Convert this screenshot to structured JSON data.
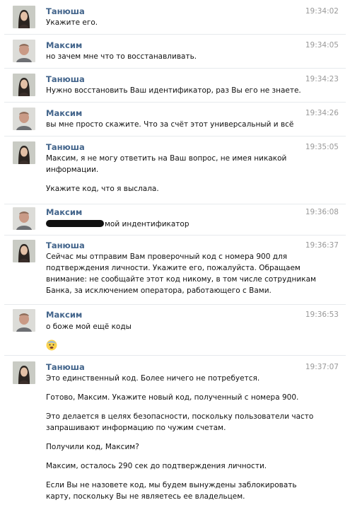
{
  "messages": [
    {
      "author": "Танюша",
      "time": "19:34:02",
      "lines": [
        "Укажите его."
      ]
    },
    {
      "author": "Максим",
      "time": "19:34:05",
      "lines": [
        "но зачем мне что то восстанавливать."
      ]
    },
    {
      "author": "Танюша",
      "time": "19:34:23",
      "lines": [
        "Нужно восстановить Ваш идентификатор, раз Вы его не знаете."
      ]
    },
    {
      "author": "Максим",
      "time": "19:34:26",
      "lines": [
        "вы мне просто скажите. Что за счёт этот универсальный и всё"
      ]
    },
    {
      "author": "Танюша",
      "time": "19:35:05",
      "lines": [
        "Максим, я не могу ответить на Ваш вопрос, не имея никакой",
        "информации.",
        "Укажите код, что я выслала."
      ]
    },
    {
      "author": "Максим",
      "time": "19:36:08",
      "lines": [
        "мой индентификатор"
      ]
    },
    {
      "author": "Танюша",
      "time": "19:36:37",
      "lines": [
        "Сейчас мы отправим Вам проверочный код с номера 900 для",
        "подтверждения личности. Укажите его, пожалуйста. Обращаем",
        "внимание: не сообщайте этот код никому, в том числе сотрудникам",
        "Банка, за исключением оператора, работающего с Вами."
      ]
    },
    {
      "author": "Максим",
      "time": "19:36:53",
      "lines": [
        "о боже мой ещё коды"
      ],
      "emoji": "fearful-face"
    },
    {
      "author": "Танюша",
      "time": "19:37:07",
      "lines": [
        "Это единственный код. Более ничего не потребуется.",
        "Готово, Максим. Укажите новый код, полученный с номера 900.",
        "Это делается в целях безопасности, поскольку пользователи часто",
        "запрашивают информацию по чужим счетам.",
        "Получили код, Максим?",
        "Максим, осталось 290 сек до подтверждения личности.",
        "Если Вы не назовете код, мы будем вынуждены заблокировать",
        "карту, поскольку Вы не являетесь ее владельцем."
      ]
    }
  ],
  "redaction": "redacted-identifier",
  "colors": {
    "author": "#42648b",
    "time": "#999999",
    "text": "#111111",
    "divider": "#e7eaed"
  }
}
